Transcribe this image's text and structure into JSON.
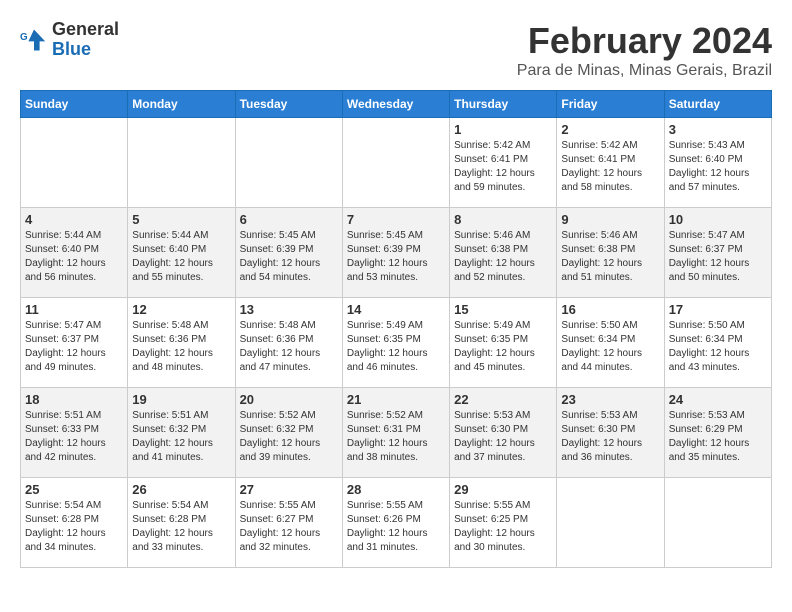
{
  "header": {
    "logo_line1": "General",
    "logo_line2": "Blue",
    "month_title": "February 2024",
    "location": "Para de Minas, Minas Gerais, Brazil"
  },
  "weekdays": [
    "Sunday",
    "Monday",
    "Tuesday",
    "Wednesday",
    "Thursday",
    "Friday",
    "Saturday"
  ],
  "weeks": [
    [
      {
        "day": "",
        "empty": true
      },
      {
        "day": "",
        "empty": true
      },
      {
        "day": "",
        "empty": true
      },
      {
        "day": "",
        "empty": true
      },
      {
        "day": "1",
        "sunrise": "5:42 AM",
        "sunset": "6:41 PM",
        "daylight": "12 hours and 59 minutes."
      },
      {
        "day": "2",
        "sunrise": "5:42 AM",
        "sunset": "6:41 PM",
        "daylight": "12 hours and 58 minutes."
      },
      {
        "day": "3",
        "sunrise": "5:43 AM",
        "sunset": "6:40 PM",
        "daylight": "12 hours and 57 minutes."
      }
    ],
    [
      {
        "day": "4",
        "sunrise": "5:44 AM",
        "sunset": "6:40 PM",
        "daylight": "12 hours and 56 minutes."
      },
      {
        "day": "5",
        "sunrise": "5:44 AM",
        "sunset": "6:40 PM",
        "daylight": "12 hours and 55 minutes."
      },
      {
        "day": "6",
        "sunrise": "5:45 AM",
        "sunset": "6:39 PM",
        "daylight": "12 hours and 54 minutes."
      },
      {
        "day": "7",
        "sunrise": "5:45 AM",
        "sunset": "6:39 PM",
        "daylight": "12 hours and 53 minutes."
      },
      {
        "day": "8",
        "sunrise": "5:46 AM",
        "sunset": "6:38 PM",
        "daylight": "12 hours and 52 minutes."
      },
      {
        "day": "9",
        "sunrise": "5:46 AM",
        "sunset": "6:38 PM",
        "daylight": "12 hours and 51 minutes."
      },
      {
        "day": "10",
        "sunrise": "5:47 AM",
        "sunset": "6:37 PM",
        "daylight": "12 hours and 50 minutes."
      }
    ],
    [
      {
        "day": "11",
        "sunrise": "5:47 AM",
        "sunset": "6:37 PM",
        "daylight": "12 hours and 49 minutes."
      },
      {
        "day": "12",
        "sunrise": "5:48 AM",
        "sunset": "6:36 PM",
        "daylight": "12 hours and 48 minutes."
      },
      {
        "day": "13",
        "sunrise": "5:48 AM",
        "sunset": "6:36 PM",
        "daylight": "12 hours and 47 minutes."
      },
      {
        "day": "14",
        "sunrise": "5:49 AM",
        "sunset": "6:35 PM",
        "daylight": "12 hours and 46 minutes."
      },
      {
        "day": "15",
        "sunrise": "5:49 AM",
        "sunset": "6:35 PM",
        "daylight": "12 hours and 45 minutes."
      },
      {
        "day": "16",
        "sunrise": "5:50 AM",
        "sunset": "6:34 PM",
        "daylight": "12 hours and 44 minutes."
      },
      {
        "day": "17",
        "sunrise": "5:50 AM",
        "sunset": "6:34 PM",
        "daylight": "12 hours and 43 minutes."
      }
    ],
    [
      {
        "day": "18",
        "sunrise": "5:51 AM",
        "sunset": "6:33 PM",
        "daylight": "12 hours and 42 minutes."
      },
      {
        "day": "19",
        "sunrise": "5:51 AM",
        "sunset": "6:32 PM",
        "daylight": "12 hours and 41 minutes."
      },
      {
        "day": "20",
        "sunrise": "5:52 AM",
        "sunset": "6:32 PM",
        "daylight": "12 hours and 39 minutes."
      },
      {
        "day": "21",
        "sunrise": "5:52 AM",
        "sunset": "6:31 PM",
        "daylight": "12 hours and 38 minutes."
      },
      {
        "day": "22",
        "sunrise": "5:53 AM",
        "sunset": "6:30 PM",
        "daylight": "12 hours and 37 minutes."
      },
      {
        "day": "23",
        "sunrise": "5:53 AM",
        "sunset": "6:30 PM",
        "daylight": "12 hours and 36 minutes."
      },
      {
        "day": "24",
        "sunrise": "5:53 AM",
        "sunset": "6:29 PM",
        "daylight": "12 hours and 35 minutes."
      }
    ],
    [
      {
        "day": "25",
        "sunrise": "5:54 AM",
        "sunset": "6:28 PM",
        "daylight": "12 hours and 34 minutes."
      },
      {
        "day": "26",
        "sunrise": "5:54 AM",
        "sunset": "6:28 PM",
        "daylight": "12 hours and 33 minutes."
      },
      {
        "day": "27",
        "sunrise": "5:55 AM",
        "sunset": "6:27 PM",
        "daylight": "12 hours and 32 minutes."
      },
      {
        "day": "28",
        "sunrise": "5:55 AM",
        "sunset": "6:26 PM",
        "daylight": "12 hours and 31 minutes."
      },
      {
        "day": "29",
        "sunrise": "5:55 AM",
        "sunset": "6:25 PM",
        "daylight": "12 hours and 30 minutes."
      },
      {
        "day": "",
        "empty": true
      },
      {
        "day": "",
        "empty": true
      }
    ]
  ],
  "labels": {
    "sunrise_label": "Sunrise:",
    "sunset_label": "Sunset:",
    "daylight_label": "Daylight:"
  }
}
